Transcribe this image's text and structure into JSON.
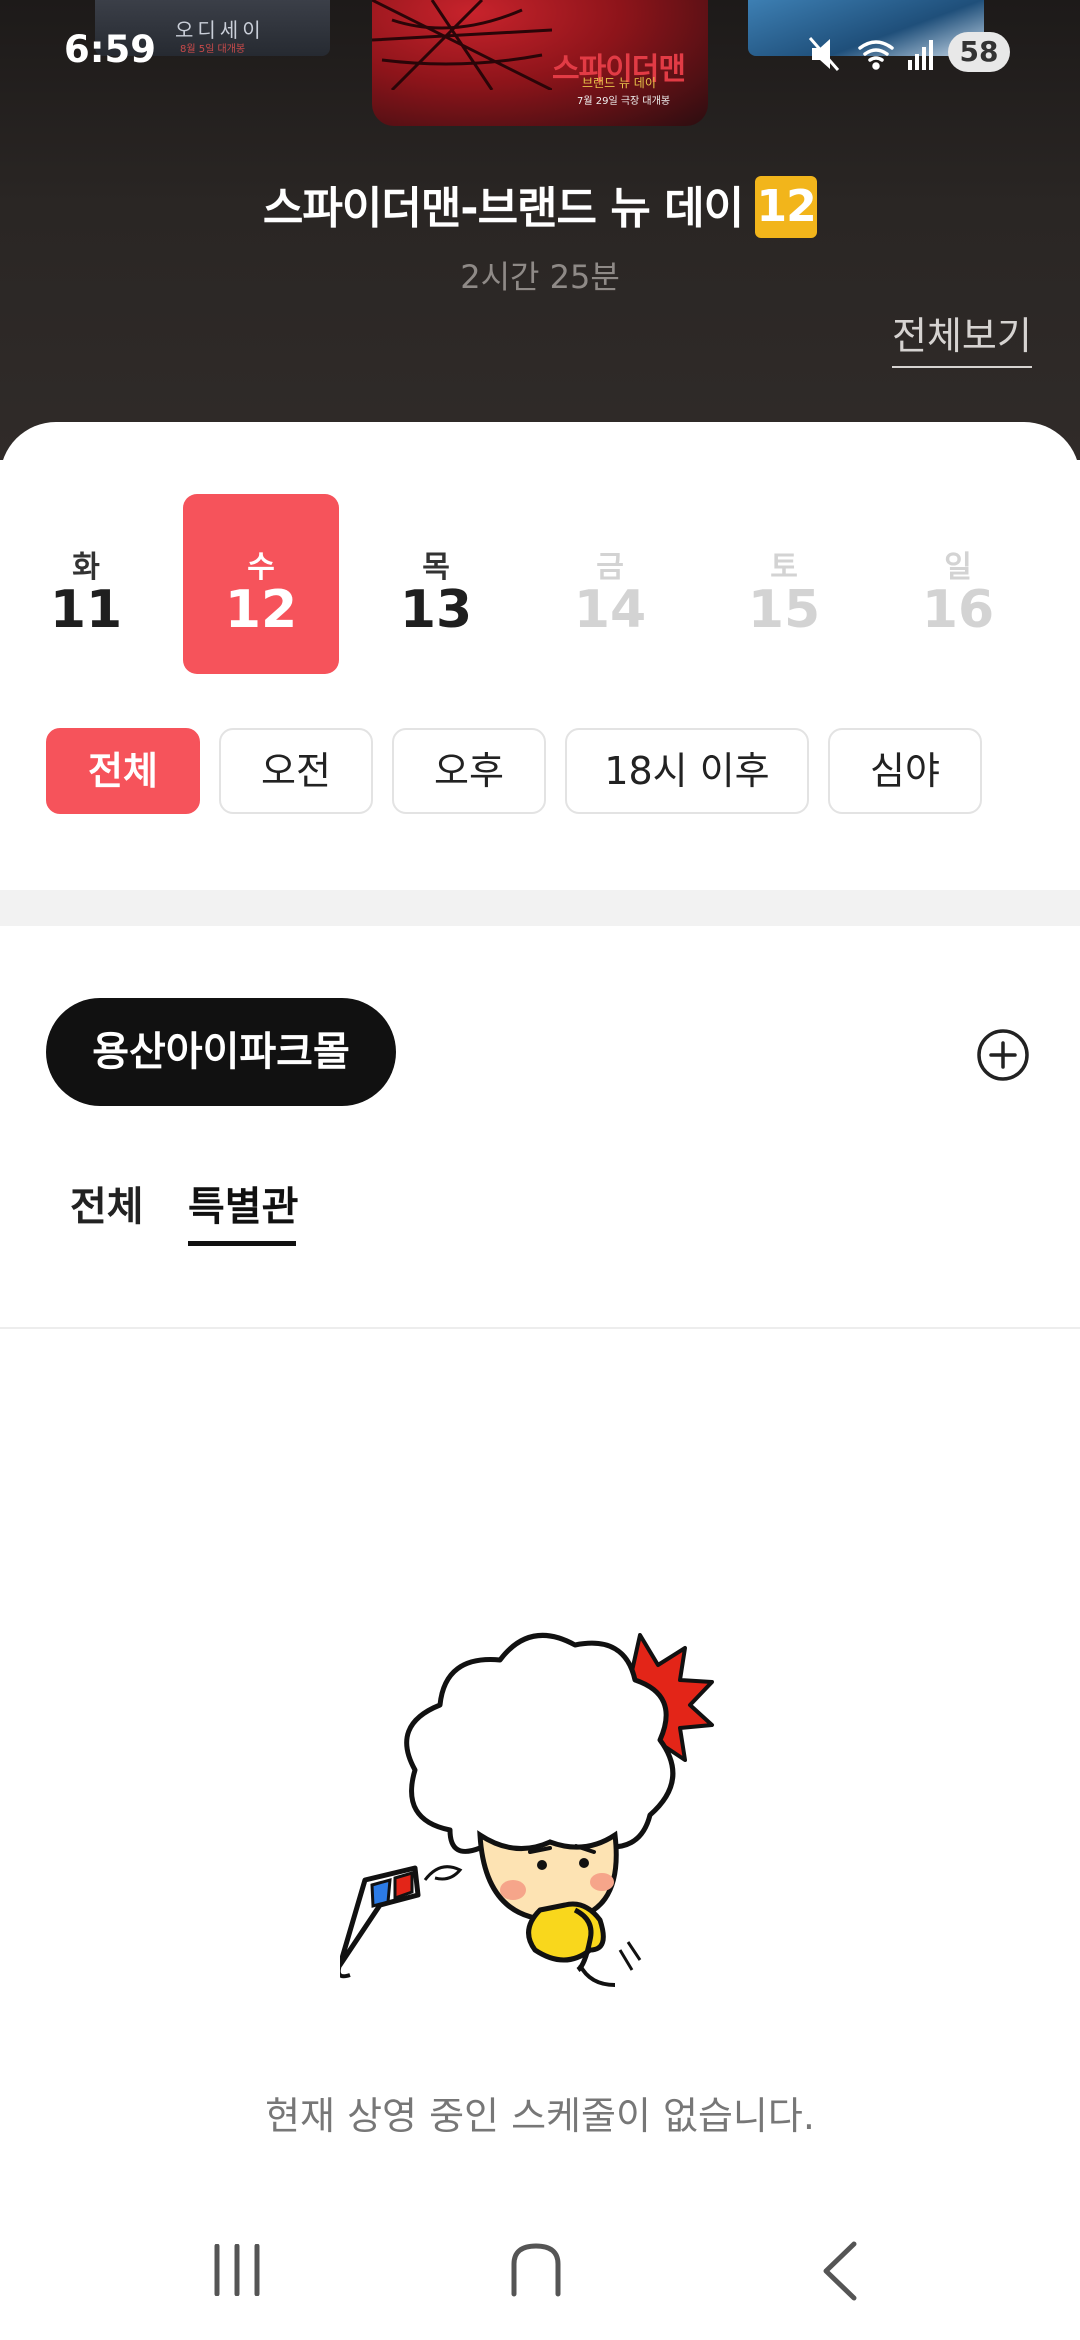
{
  "status_bar": {
    "time": "6:59",
    "battery": "58"
  },
  "movie": {
    "title": "스파이더맨-브랜드 뉴 데이",
    "age_rating": "12",
    "runtime": "2시간 25분",
    "view_all": "전체보기",
    "poster_left_title": "오디세이",
    "poster_left_sub": "8월 5일 대개봉",
    "poster_main_title": "스파이더맨",
    "poster_main_sub": "브랜드 뉴 데이",
    "poster_main_date": "7월 29일 극장 대개봉"
  },
  "dates": [
    {
      "weekday": "화",
      "day": "11",
      "state": "normal"
    },
    {
      "weekday": "수",
      "day": "12",
      "state": "selected"
    },
    {
      "weekday": "목",
      "day": "13",
      "state": "normal"
    },
    {
      "weekday": "금",
      "day": "14",
      "state": "disabled"
    },
    {
      "weekday": "토",
      "day": "15",
      "state": "disabled"
    },
    {
      "weekday": "일",
      "day": "16",
      "state": "disabled"
    }
  ],
  "time_filters": [
    "전체",
    "오전",
    "오후",
    "18시 이후",
    "심야"
  ],
  "active_time_filter": "전체",
  "theater": {
    "name": "용산아이파크몰",
    "add_icon": "plus-circle-icon"
  },
  "tabs": [
    {
      "label": "전체",
      "selected": false
    },
    {
      "label": "특별관",
      "selected": true
    }
  ],
  "empty_state": {
    "message": "현재 상영 중인 스케줄이 없습니다."
  },
  "nav_bar": {
    "recent_icon": "recent-apps-icon",
    "home_icon": "home-icon",
    "back_icon": "back-icon"
  },
  "colors": {
    "accent": "#f6535b",
    "age_badge": "#f2b51b",
    "pill": "#111111"
  }
}
